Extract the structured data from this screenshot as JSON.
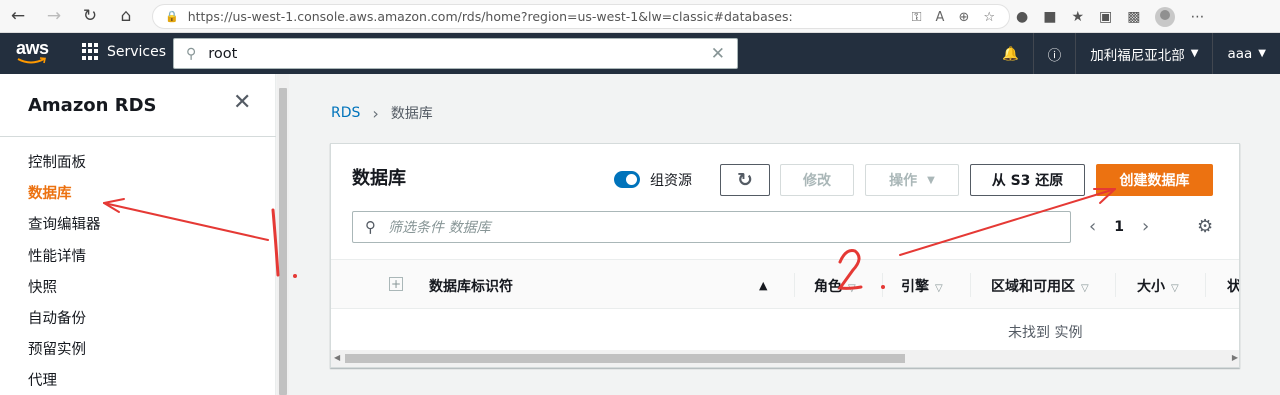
{
  "browser": {
    "url": "https://us-west-1.console.aws.amazon.com/rds/home?region=us-west-1&lw=classic#databases:"
  },
  "header": {
    "logo_text": "aws",
    "services_label": "Services",
    "search_value": "root",
    "region_label": "加利福尼亚北部",
    "user_label": "aaa"
  },
  "sidebar": {
    "title": "Amazon RDS",
    "items": [
      {
        "label": "控制面板"
      },
      {
        "label": "数据库"
      },
      {
        "label": "查询编辑器"
      },
      {
        "label": "性能详情"
      },
      {
        "label": "快照"
      },
      {
        "label": "自动备份"
      },
      {
        "label": "预留实例"
      },
      {
        "label": "代理"
      }
    ]
  },
  "breadcrumb": {
    "root": "RDS",
    "current": "数据库"
  },
  "panel": {
    "title": "数据库",
    "toggle_label": "组资源",
    "buttons": {
      "modify": "修改",
      "actions": "操作",
      "restore_s3": "从 S3 还原",
      "create": "创建数据库"
    },
    "filter_placeholder": "筛选条件 数据库",
    "page_number": "1",
    "columns": [
      "数据库标识符",
      "角色",
      "引擎",
      "区域和可用区",
      "大小",
      "状"
    ],
    "empty_message": "未找到 实例"
  },
  "annotations": {
    "label_1": "1.",
    "label_2": "2 ."
  },
  "colors": {
    "aws_nav": "#232f3e",
    "accent_orange": "#ec7211",
    "link_blue": "#0073bb",
    "annotation_red": "#e53935"
  }
}
